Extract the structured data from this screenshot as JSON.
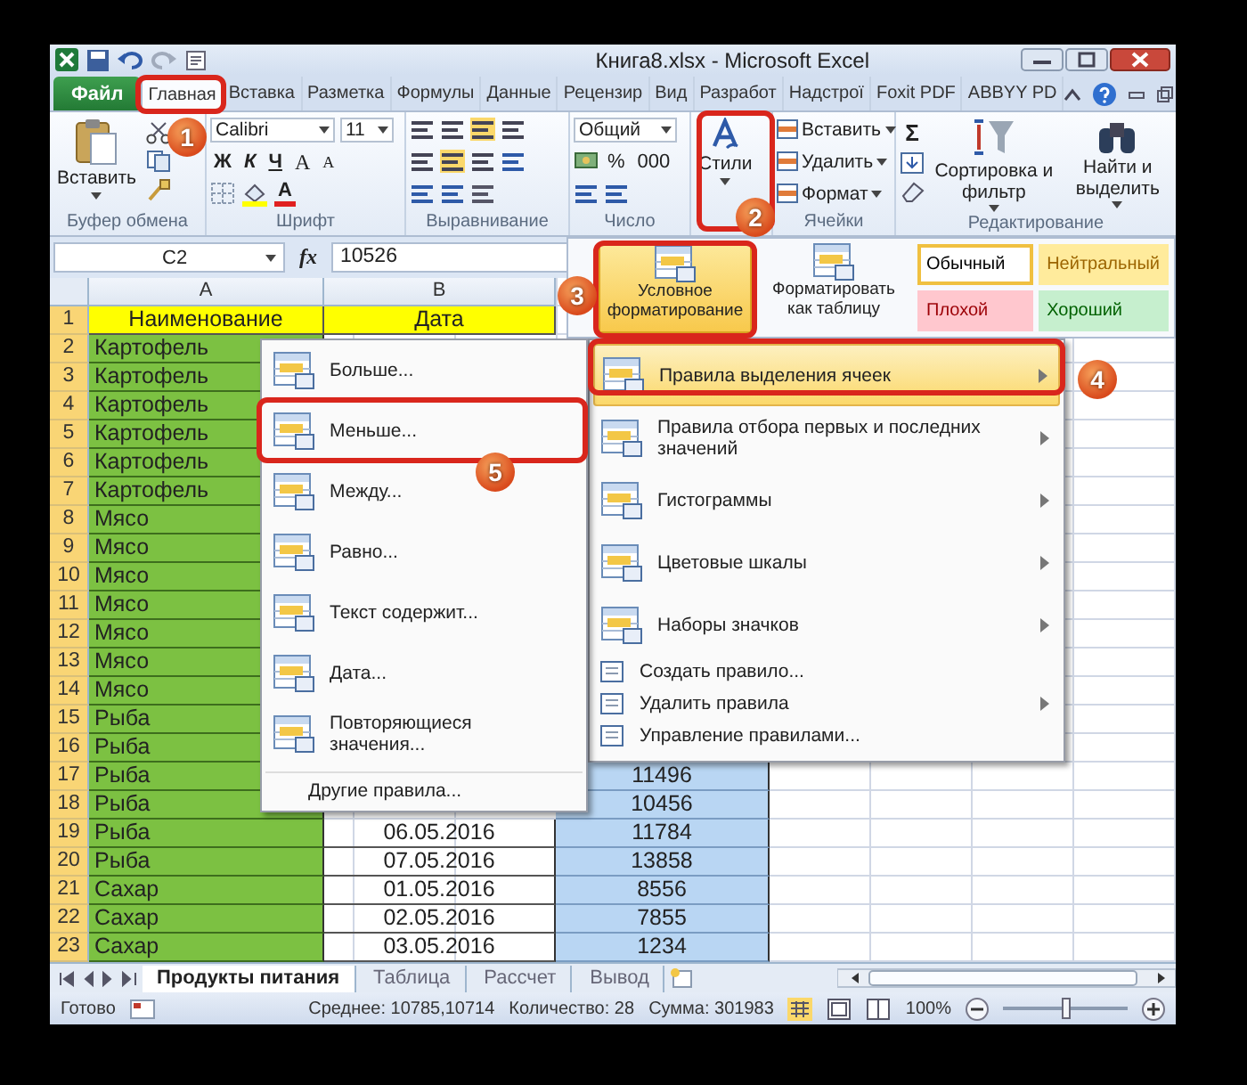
{
  "window": {
    "title": "Книга8.xlsx - Microsoft Excel"
  },
  "ribbon_tabs": [
    {
      "label": "Файл",
      "kind": "file",
      "selected": false
    },
    {
      "label": "Главная",
      "kind": "tab",
      "selected": true
    },
    {
      "label": "Вставка",
      "kind": "tab",
      "selected": false
    },
    {
      "label": "Разметка",
      "kind": "tab",
      "selected": false
    },
    {
      "label": "Формулы",
      "kind": "tab",
      "selected": false
    },
    {
      "label": "Данные",
      "kind": "tab",
      "selected": false
    },
    {
      "label": "Рецензир",
      "kind": "tab",
      "selected": false
    },
    {
      "label": "Вид",
      "kind": "tab",
      "selected": false
    },
    {
      "label": "Разработ",
      "kind": "tab",
      "selected": false
    },
    {
      "label": "Надстрої",
      "kind": "tab",
      "selected": false
    },
    {
      "label": "Foxit PDF",
      "kind": "tab",
      "selected": false
    },
    {
      "label": "ABBYY PD",
      "kind": "tab",
      "selected": false
    }
  ],
  "clipboard": {
    "paste": "Вставить",
    "label": "Буфер обмена"
  },
  "font": {
    "name": "Calibri",
    "size": "11",
    "bold": "Ж",
    "italic": "К",
    "underline": "Ч",
    "grow": "A",
    "shrink": "A",
    "color_button": "A",
    "label": "Шрифт"
  },
  "alignment": {
    "label": "Выравнивание"
  },
  "number": {
    "format": "Общий",
    "percent": "%",
    "thousands": "000",
    "label": "Число"
  },
  "styles": {
    "button": "Стили"
  },
  "cells": {
    "items": [
      "Вставить",
      "Удалить",
      "Формат"
    ],
    "label": "Ячейки"
  },
  "editing": {
    "sum": "Σ",
    "sort": "Сортировка и фильтр",
    "find": "Найти и выделить",
    "label": "Редактирование"
  },
  "formula_bar": {
    "name_box": "C2",
    "fx": "fx",
    "value": "10526"
  },
  "styles_gallery": {
    "conditional": "Условное форматирование",
    "format_table": "Форматировать как таблицу",
    "cell_styles": [
      {
        "label": "Обычный",
        "kind": "normal"
      },
      {
        "label": "Нейтральный",
        "kind": "neutral"
      },
      {
        "label": "Плохой",
        "kind": "bad"
      },
      {
        "label": "Хороший",
        "kind": "good"
      }
    ]
  },
  "sheet": {
    "columns": [
      "A",
      "B"
    ],
    "header_num": "1",
    "header": [
      "Наименование",
      "Дата"
    ],
    "rows": [
      {
        "num": "2",
        "name": "Картофель"
      },
      {
        "num": "3",
        "name": "Картофель"
      },
      {
        "num": "4",
        "name": "Картофель"
      },
      {
        "num": "5",
        "name": "Картофель"
      },
      {
        "num": "6",
        "name": "Картофель"
      },
      {
        "num": "7",
        "name": "Картофель"
      },
      {
        "num": "8",
        "name": "Мясо"
      },
      {
        "num": "9",
        "name": "Мясо"
      },
      {
        "num": "10",
        "name": "Мясо"
      },
      {
        "num": "11",
        "name": "Мясо"
      },
      {
        "num": "12",
        "name": "Мясо"
      },
      {
        "num": "13",
        "name": "Мясо"
      },
      {
        "num": "14",
        "name": "Мясо"
      },
      {
        "num": "15",
        "name": "Рыба"
      },
      {
        "num": "16",
        "name": "Рыба"
      },
      {
        "num": "17",
        "name": "Рыба",
        "value": "11496"
      },
      {
        "num": "18",
        "name": "Рыба",
        "value": "10456"
      },
      {
        "num": "19",
        "name": "Рыба",
        "date": "06.05.2016",
        "value": "11784"
      },
      {
        "num": "20",
        "name": "Рыба",
        "date": "07.05.2016",
        "value": "13858"
      },
      {
        "num": "21",
        "name": "Сахар",
        "date": "01.05.2016",
        "value": "8556"
      },
      {
        "num": "22",
        "name": "Сахар",
        "date": "02.05.2016",
        "value": "7855"
      },
      {
        "num": "23",
        "name": "Сахар",
        "date": "03.05.2016",
        "value": "1234"
      }
    ]
  },
  "conditional_menu": {
    "items": [
      {
        "label": "Правила выделения ячеек",
        "kind": "main",
        "submenu": true,
        "selected": true
      },
      {
        "label": "Правила отбора первых и последних значений",
        "kind": "main",
        "submenu": true,
        "selected": false
      },
      {
        "label": "Гистограммы",
        "kind": "main",
        "submenu": true,
        "selected": false
      },
      {
        "label": "Цветовые шкалы",
        "kind": "main",
        "submenu": true,
        "selected": false
      },
      {
        "label": "Наборы значков",
        "kind": "main",
        "submenu": true,
        "selected": false
      },
      {
        "label": "Создать правило...",
        "kind": "small",
        "submenu": false,
        "selected": false
      },
      {
        "label": "Удалить правила",
        "kind": "small",
        "submenu": true,
        "selected": false
      },
      {
        "label": "Управление правилами...",
        "kind": "small",
        "submenu": false,
        "selected": false
      }
    ]
  },
  "highlight_menu": {
    "items": [
      "Больше...",
      "Меньше...",
      "Между...",
      "Равно...",
      "Текст содержит...",
      "Дата...",
      "Повторяющиеся значения..."
    ],
    "more": "Другие правила..."
  },
  "callouts": [
    "1",
    "2",
    "3",
    "4",
    "5"
  ],
  "sheet_tabs": [
    {
      "label": "Продукты питания",
      "selected": true
    },
    {
      "label": "Таблица",
      "selected": false
    },
    {
      "label": "Рассчет",
      "selected": false
    },
    {
      "label": "Вывод",
      "selected": false
    }
  ],
  "status_bar": {
    "ready": "Готово",
    "average": "Среднее: 10785,10714",
    "count": "Количество: 28",
    "sum": "Сумма: 301983",
    "zoom": {
      "label": "100%",
      "level": 0.5
    }
  }
}
